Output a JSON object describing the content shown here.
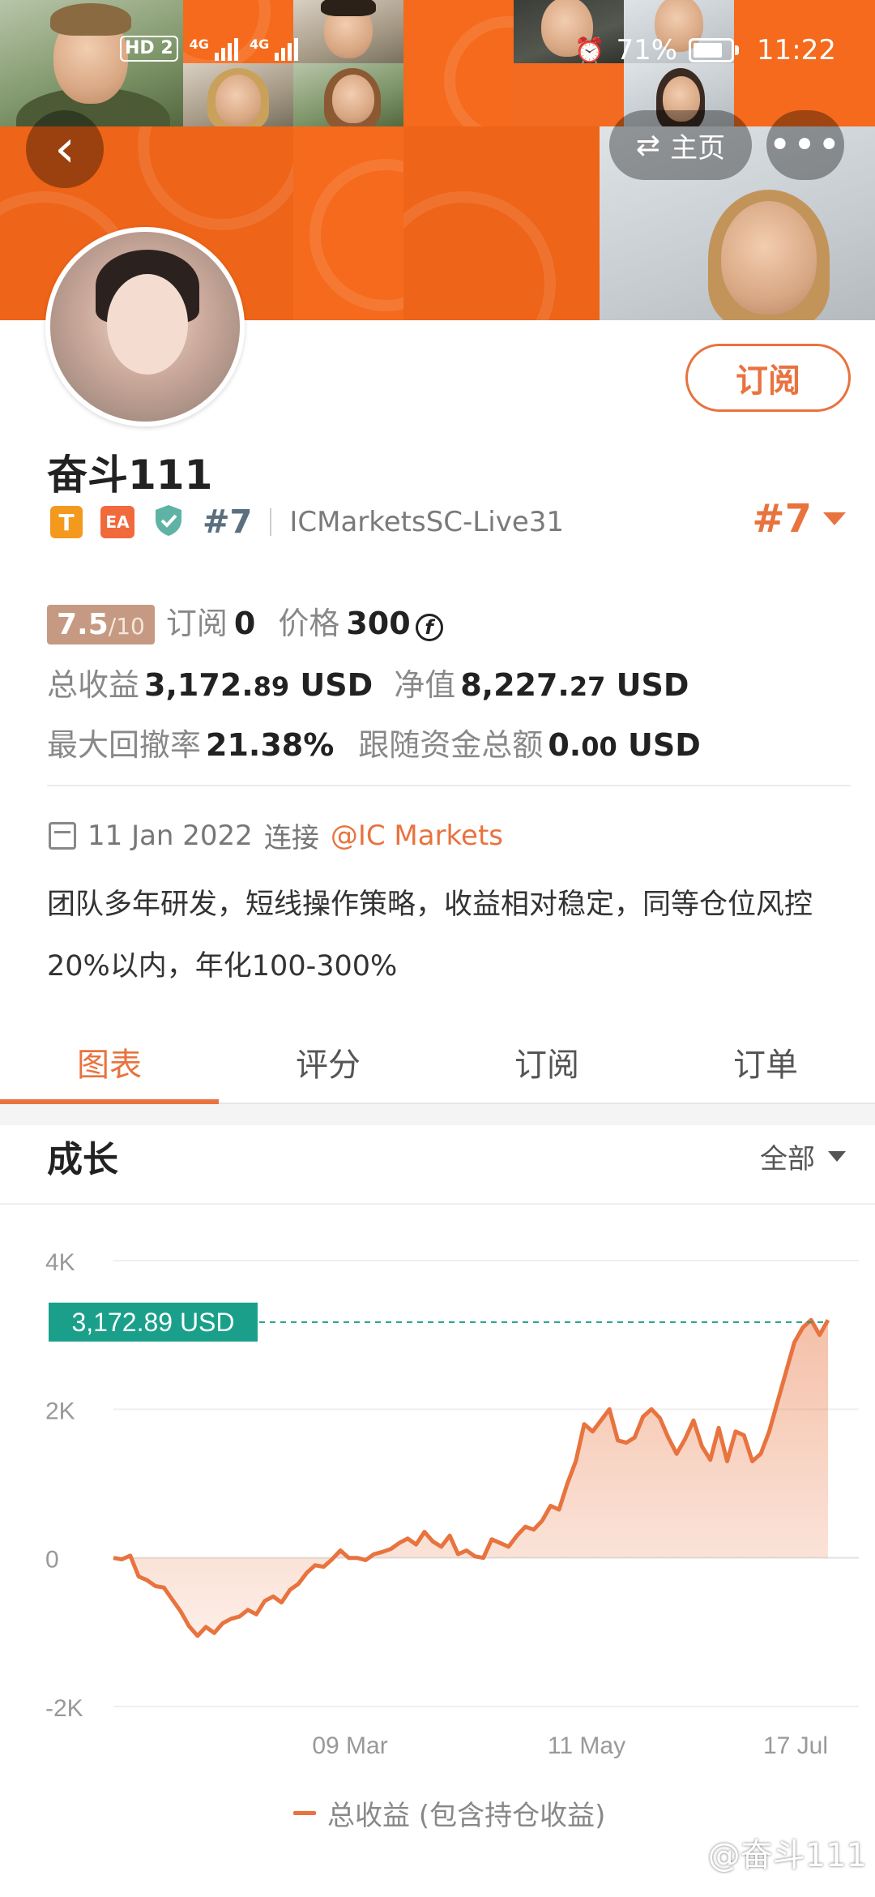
{
  "status_bar": {
    "hd_label": "HD",
    "sim_label": "2",
    "net1": "4G",
    "net2": "4G",
    "battery": "71%",
    "time": "11:22"
  },
  "header": {
    "home_label": "主页",
    "more_label": "•••"
  },
  "profile": {
    "name": "奋斗111",
    "badge_t": "T",
    "badge_ea": "EA",
    "rank_small": "#7",
    "server": "ICMarketsSC-Live31",
    "rank_big": "#7",
    "subscribe_label": "订阅"
  },
  "stats": {
    "score": "7.5",
    "score_max": "/10",
    "subscribe_label": "订阅",
    "subscribe_count": "0",
    "price_label": "价格",
    "price_value": "300",
    "coin_symbol": "f",
    "total_profit_label": "总收益",
    "total_profit_int": "3,172.",
    "total_profit_dec": "89",
    "net_value_label": "净值",
    "net_value_int": "8,227.",
    "net_value_dec": "27",
    "currency": "USD",
    "drawdown_label": "最大回撤率",
    "drawdown_value": "21.38%",
    "follow_label": "跟随资金总额",
    "follow_int": "0.",
    "follow_dec": "00"
  },
  "meta": {
    "date": "11 Jan 2022",
    "connect_label": "连接",
    "broker": "@IC Markets"
  },
  "description": "团队多年研发，短线操作策略，收益相对稳定，同等仓位风控20%以内，年化100-300%",
  "tabs": [
    "图表",
    "评分",
    "订阅",
    "订单"
  ],
  "growth": {
    "title": "成长",
    "filter_label": "全部"
  },
  "chart_data": {
    "type": "area",
    "title": "",
    "y_ticks": [
      "4K",
      "2K",
      "0",
      "-2K"
    ],
    "x_ticks": [
      "09 Mar",
      "11 May",
      "17 Jul"
    ],
    "ylim": [
      -2000,
      4000
    ],
    "current_label": "3,172.89 USD",
    "current_value": 3172.89,
    "series_name": "总收益 (包含持仓收益)",
    "values": [
      0,
      -20,
      30,
      -250,
      -300,
      -380,
      -400,
      -560,
      -720,
      -920,
      -1050,
      -930,
      -1010,
      -880,
      -820,
      -790,
      -700,
      -760,
      -580,
      -520,
      -600,
      -430,
      -350,
      -200,
      -100,
      -120,
      -20,
      100,
      0,
      0,
      -30,
      50,
      80,
      120,
      200,
      260,
      180,
      350,
      220,
      150,
      300,
      50,
      100,
      20,
      0,
      250,
      200,
      150,
      300,
      420,
      380,
      500,
      700,
      650,
      1000,
      1300,
      1800,
      1700,
      1850,
      2000,
      1580,
      1550,
      1620,
      1900,
      2000,
      1880,
      1620,
      1400,
      1600,
      1850,
      1500,
      1320,
      1750,
      1300,
      1700,
      1650,
      1300,
      1400,
      1700,
      2100,
      2500,
      2900,
      3100,
      3200,
      3000,
      3200
    ]
  },
  "colors": {
    "accent": "#e8733e",
    "price_tag": "#1aa08a"
  },
  "watermark": "@奋斗111"
}
